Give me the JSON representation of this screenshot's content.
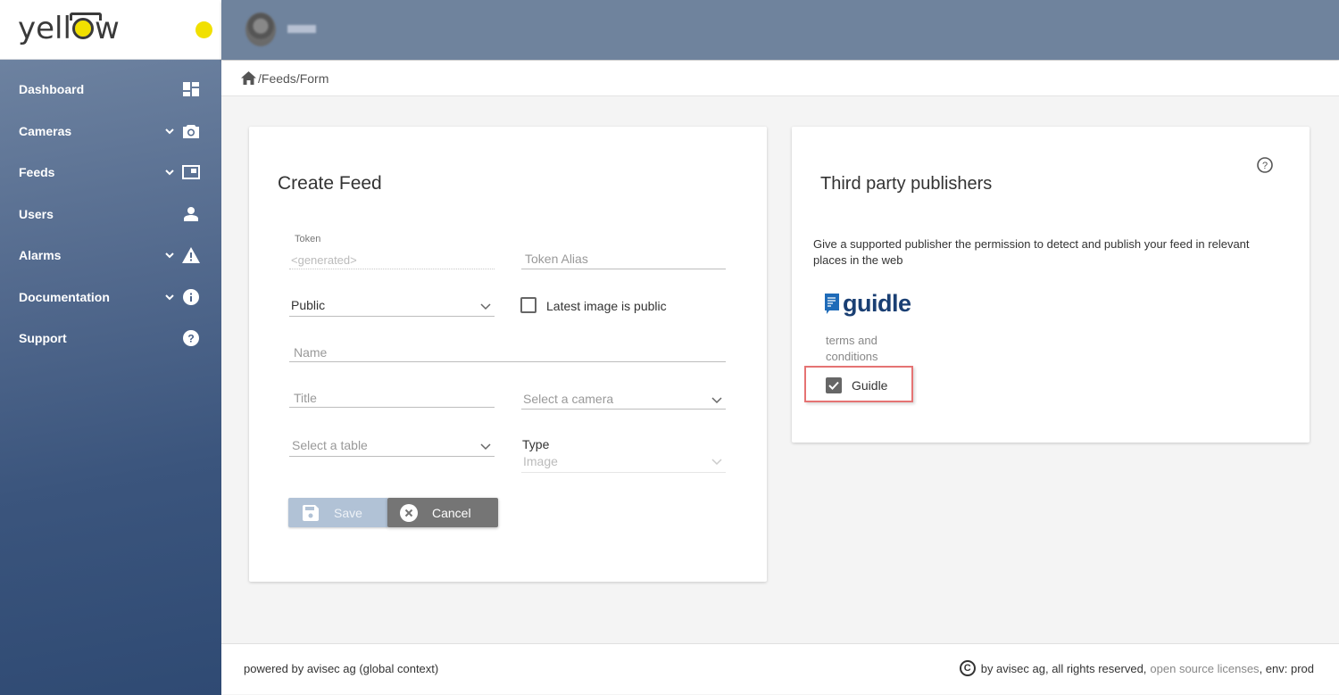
{
  "app": {
    "logo_prefix": "yel",
    "logo_suffix": "w",
    "logo_l": "l",
    "status_color": "#f1e000"
  },
  "user": {
    "name_blurred": true
  },
  "sidebar": {
    "items": [
      {
        "label": "Dashboard",
        "icon": "dashboard-icon",
        "expandable": false
      },
      {
        "label": "Cameras",
        "icon": "camera-icon",
        "expandable": true
      },
      {
        "label": "Feeds",
        "icon": "feed-icon",
        "expandable": true
      },
      {
        "label": "Users",
        "icon": "user-icon",
        "expandable": false
      },
      {
        "label": "Alarms",
        "icon": "warning-icon",
        "expandable": true
      },
      {
        "label": "Documentation",
        "icon": "info-icon",
        "expandable": true
      },
      {
        "label": "Support",
        "icon": "help-icon",
        "expandable": false
      }
    ]
  },
  "breadcrumb": {
    "sep1": "/",
    "feeds": "Feeds",
    "sep2": "/",
    "form": "Form"
  },
  "create_feed": {
    "title": "Create Feed",
    "token_label": "Token",
    "token_placeholder": "<generated>",
    "token_alias_placeholder": "Token Alias",
    "visibility_value": "Public",
    "latest_image_public_label": "Latest image is public",
    "latest_image_public_checked": false,
    "name_placeholder": "Name",
    "title_placeholder": "Title",
    "camera_placeholder": "Select a camera",
    "table_placeholder": "Select a table",
    "type_label": "Type",
    "type_value": "Image",
    "save_label": "Save",
    "cancel_label": "Cancel"
  },
  "third_party": {
    "title": "Third party publishers",
    "description": "Give a supported publisher the permission to detect and publish your feed in relevant places in the web",
    "publisher_logo_text": "guidle",
    "terms_text": "terms and conditions",
    "publisher_checkbox_label": "Guidle",
    "publisher_checked": true
  },
  "footer": {
    "left": "powered by avisec ag (global context)",
    "copyright_symbol": "C",
    "right_text": "by avisec ag, all rights reserved,",
    "license_link": "open source licenses",
    "env_text": ", env: prod"
  }
}
